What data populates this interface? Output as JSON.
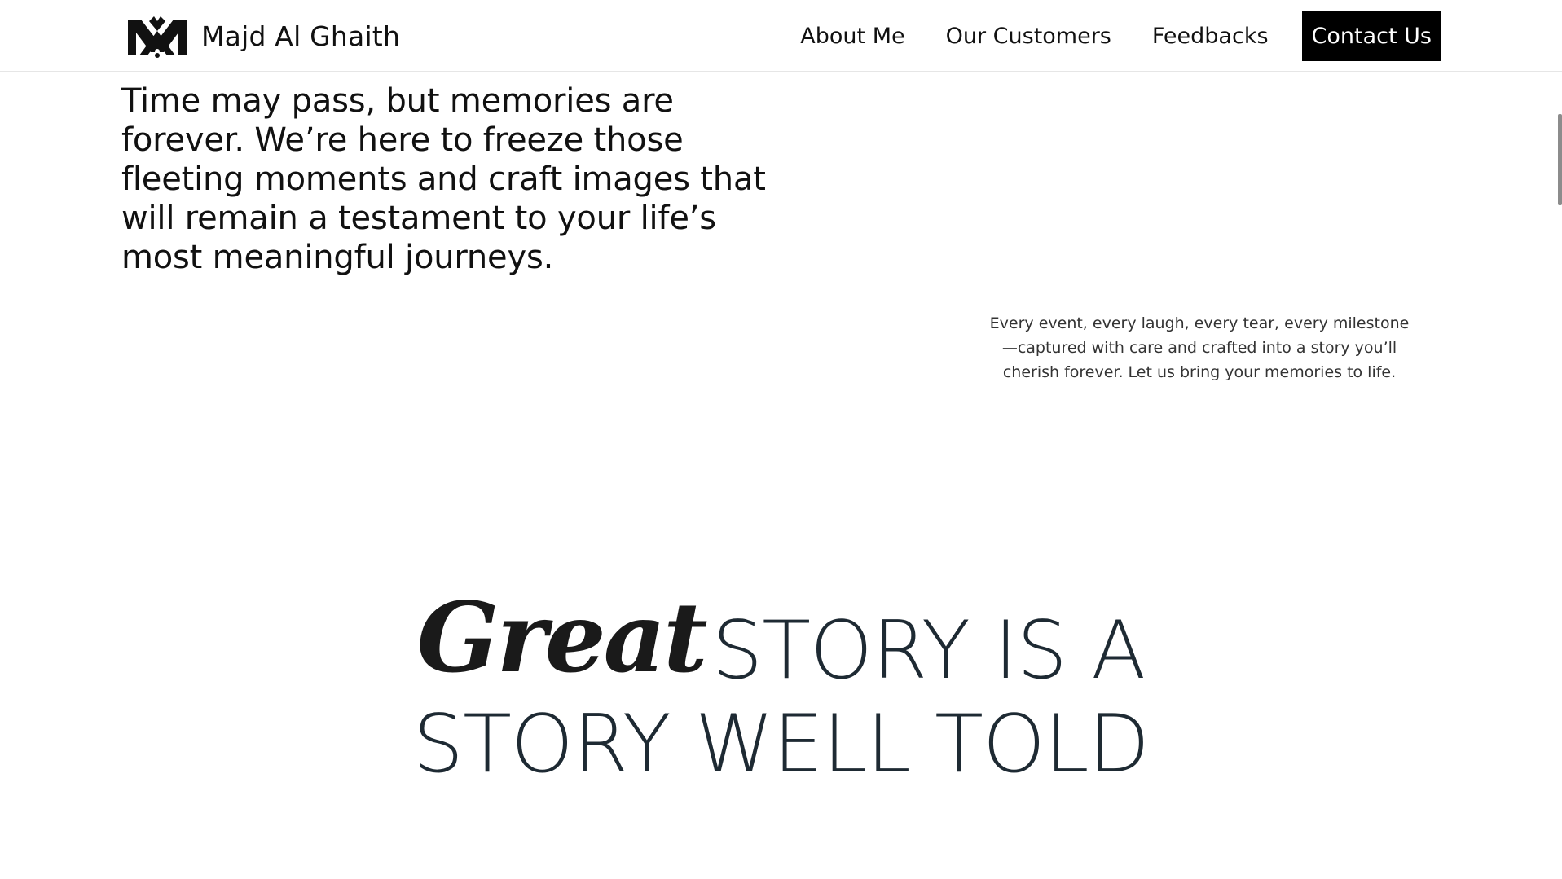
{
  "header": {
    "brand_name": "Majd Al Ghaith",
    "nav": [
      {
        "label": "About Me"
      },
      {
        "label": "Our Customers"
      },
      {
        "label": "Feedbacks"
      }
    ],
    "cta_label": "Contact Us"
  },
  "hero": {
    "lead": "Time may pass, but memories are forever. We’re here to freeze those fleeting moments and craft images that will remain a testament to your life’s most meaningful journeys.",
    "subtext": "Every event, every laugh, every tear, every milestone—captured with care and crafted into a story you’ll cherish forever. Let us bring your memories to life."
  },
  "story": {
    "accent": "Great",
    "line1_rest": "STORY IS A",
    "line2": "STORY WELL TOLD"
  },
  "colors": {
    "text": "#111111",
    "cta_bg": "#000000",
    "cta_text": "#ffffff",
    "heading": "#1e2a33"
  },
  "icons": {
    "logo": "mag-monogram-logo"
  }
}
